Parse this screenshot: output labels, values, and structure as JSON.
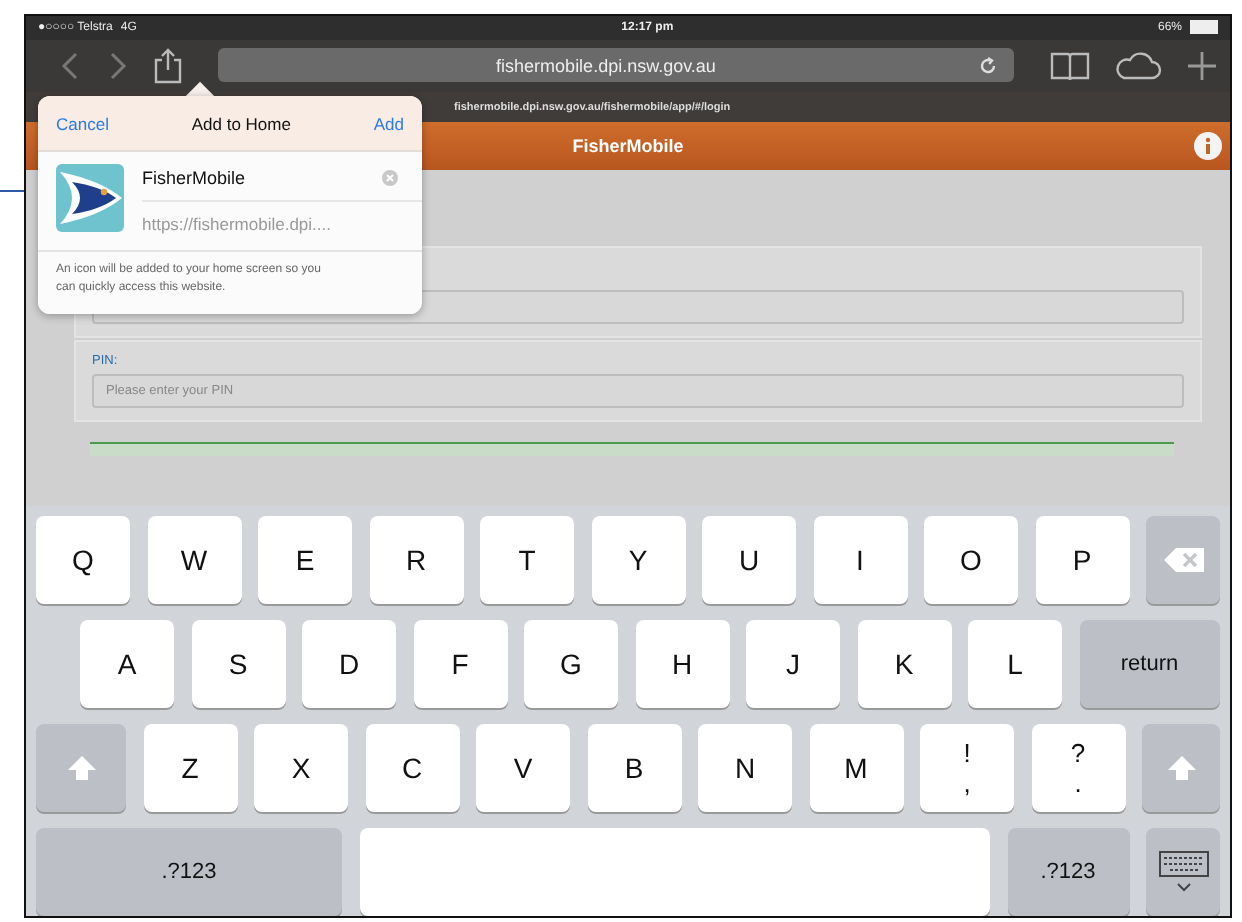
{
  "status_bar": {
    "carrier": "●○○○○ Telstra",
    "network": "4G",
    "time": "12:17 pm",
    "battery": "66%"
  },
  "toolbar": {
    "address": "fishermobile.dpi.nsw.gov.au"
  },
  "page_url": "fishermobile.dpi.nsw.gov.au/fishermobile/app/#/login",
  "app_bar": {
    "title": "FisherMobile"
  },
  "form": {
    "pin_label": "PIN:",
    "pin_placeholder": "Please enter your PIN"
  },
  "popover": {
    "cancel": "Cancel",
    "title": "Add to Home",
    "add": "Add",
    "app_name": "FisherMobile",
    "app_url": "https://fishermobile.dpi....",
    "note": "An icon will be added to your home screen so you can quickly access this website."
  },
  "keyboard": [
    [
      {
        "kind": "letter",
        "label": "Q"
      },
      {
        "kind": "letter",
        "label": "W"
      },
      {
        "kind": "letter",
        "label": "E"
      },
      {
        "kind": "letter",
        "label": "R"
      },
      {
        "kind": "letter",
        "label": "T"
      },
      {
        "kind": "letter",
        "label": "Y"
      },
      {
        "kind": "letter",
        "label": "U"
      },
      {
        "kind": "letter",
        "label": "I"
      },
      {
        "kind": "letter",
        "label": "O"
      },
      {
        "kind": "letter",
        "label": "P"
      },
      {
        "kind": "delete"
      }
    ],
    [
      {
        "kind": "letter",
        "label": "A"
      },
      {
        "kind": "letter",
        "label": "S"
      },
      {
        "kind": "letter",
        "label": "D"
      },
      {
        "kind": "letter",
        "label": "F"
      },
      {
        "kind": "letter",
        "label": "G"
      },
      {
        "kind": "letter",
        "label": "H"
      },
      {
        "kind": "letter",
        "label": "J"
      },
      {
        "kind": "letter",
        "label": "K"
      },
      {
        "kind": "letter",
        "label": "L"
      },
      {
        "kind": "return",
        "label": "return"
      }
    ],
    [
      {
        "kind": "shift"
      },
      {
        "kind": "letter",
        "label": "Z"
      },
      {
        "kind": "letter",
        "label": "X"
      },
      {
        "kind": "letter",
        "label": "C"
      },
      {
        "kind": "letter",
        "label": "V"
      },
      {
        "kind": "letter",
        "label": "B"
      },
      {
        "kind": "letter",
        "label": "N"
      },
      {
        "kind": "letter",
        "label": "M"
      },
      {
        "kind": "dual",
        "label": "!",
        "sub": ","
      },
      {
        "kind": "dual",
        "label": "?",
        "sub": "."
      },
      {
        "kind": "shift"
      }
    ],
    [
      {
        "kind": "mode",
        "label": ".?123"
      },
      {
        "kind": "space"
      },
      {
        "kind": "mode",
        "label": ".?123"
      },
      {
        "kind": "hide"
      }
    ]
  ]
}
